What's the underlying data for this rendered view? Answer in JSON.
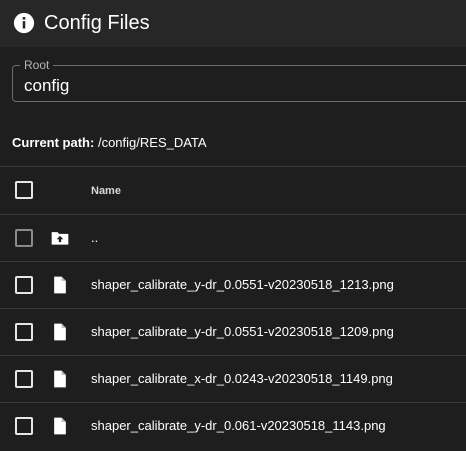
{
  "header": {
    "title": "Config Files",
    "icon": "info-icon"
  },
  "root": {
    "label": "Root",
    "value": "config"
  },
  "current_path": {
    "label": "Current path:",
    "value": "/config/RES_DATA"
  },
  "table": {
    "column_name": "Name",
    "parent_entry": "..",
    "files": [
      "shaper_calibrate_y-dr_0.0551-v20230518_1213.png",
      "shaper_calibrate_y-dr_0.0551-v20230518_1209.png",
      "shaper_calibrate_x-dr_0.0243-v20230518_1149.png",
      "shaper_calibrate_y-dr_0.061-v20230518_1143.png"
    ]
  }
}
